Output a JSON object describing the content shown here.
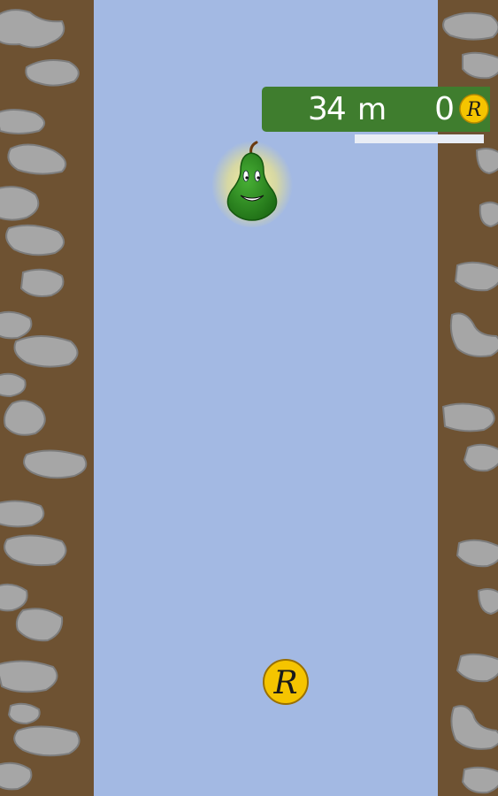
{
  "hud": {
    "distance_value": "34",
    "distance_unit": "m",
    "coin_count": "0",
    "coin_icon_letter": "R",
    "progress": 1.0
  },
  "coin_letter": "R",
  "colors": {
    "sky": "#a3b9e3",
    "dirt": "#6e5232",
    "rock": "#a6a6a6",
    "hud_panel": "#3f7d2e",
    "progress_fill": "#e9edf5",
    "coin_gold": "#f5c400",
    "pear_green": "#2e8b1f"
  },
  "icons": {
    "player": "pear-icon",
    "coin": "coin-icon"
  }
}
